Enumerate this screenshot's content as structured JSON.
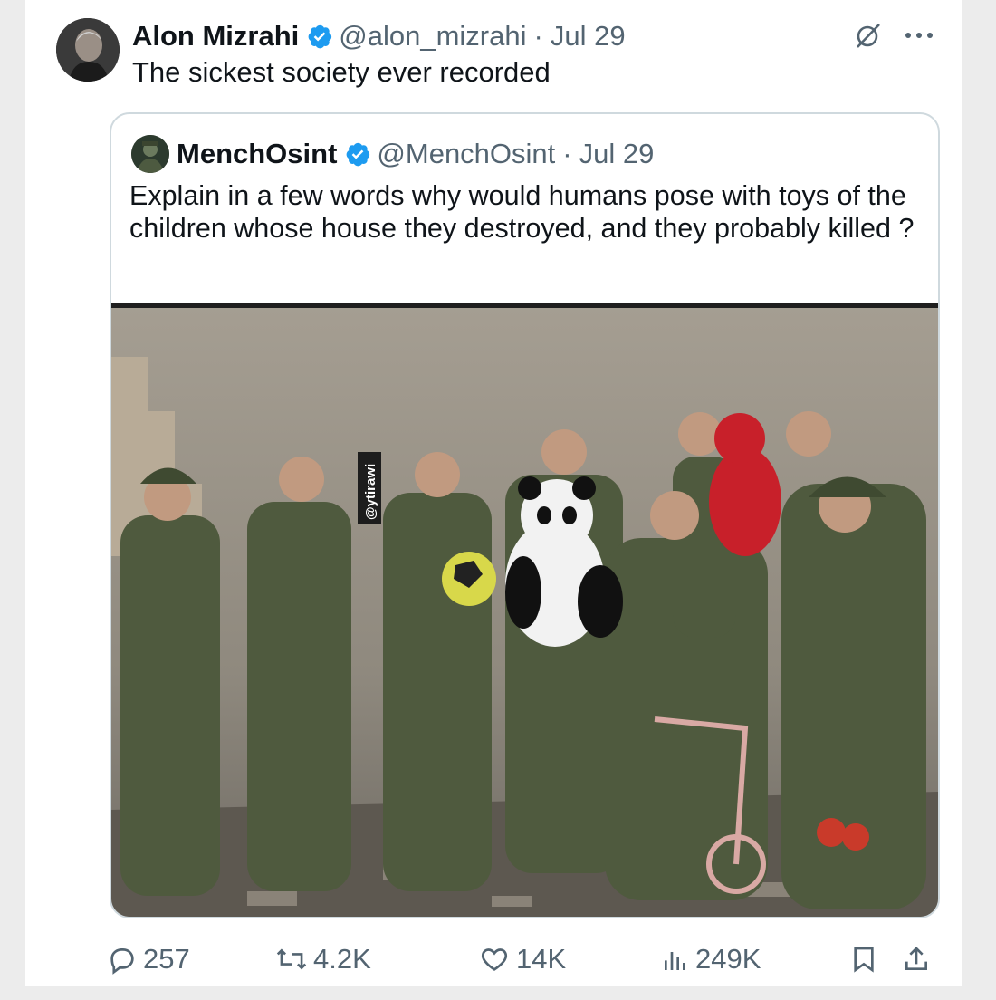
{
  "tweet": {
    "author_name": "Alon Mizrahi",
    "handle": "@alon_mizrahi",
    "separator": "·",
    "date": "Jul 29",
    "text": "The sickest society ever recorded"
  },
  "quoted_tweet": {
    "author_name": "MenchOsint",
    "handle": "@MenchOsint",
    "separator": "·",
    "date": "Jul 29",
    "text": "Explain in a few words why would humans pose with toys of the children whose house they destroyed, and they probably killed ?",
    "image_watermark": "@ytirawi"
  },
  "engagement": {
    "replies": "257",
    "reposts": "4.2K",
    "likes": "14K",
    "views": "249K"
  },
  "icons": [
    "verified-badge-icon",
    "grok-icon",
    "more-icon",
    "reply-icon",
    "repost-icon",
    "like-icon",
    "views-icon",
    "bookmark-icon",
    "share-icon"
  ],
  "colors": {
    "verified": "#1d9bf0",
    "muted": "#536471",
    "text": "#0f1419",
    "border": "#cfd9de"
  }
}
